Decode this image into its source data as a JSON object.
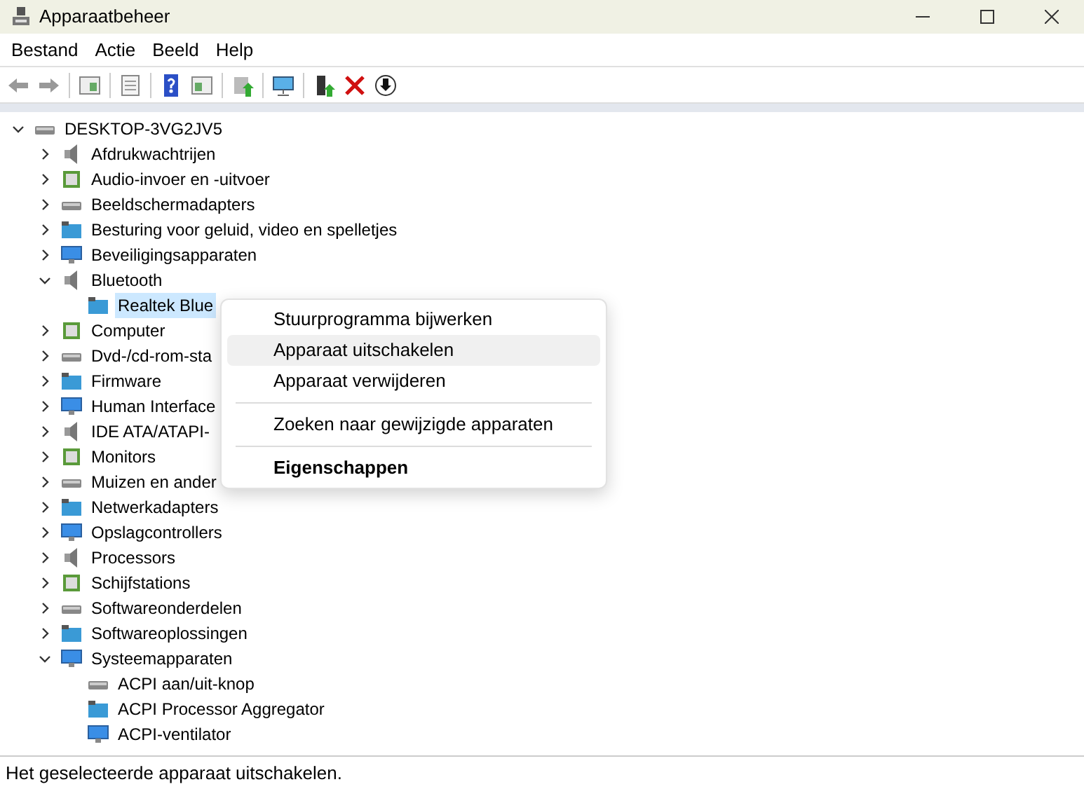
{
  "window": {
    "title": "Apparaatbeheer"
  },
  "menu_bar": [
    "Bestand",
    "Actie",
    "Beeld",
    "Help"
  ],
  "tree": {
    "label": "DESKTOP-3VG2JV5",
    "expanded": true,
    "selected": false,
    "children": [
      {
        "label": "Afdrukwachtrijen",
        "expanded": false,
        "selected": false
      },
      {
        "label": "Audio-invoer en -uitvoer",
        "expanded": false,
        "selected": false
      },
      {
        "label": "Beeldschermadapters",
        "expanded": false,
        "selected": false
      },
      {
        "label": "Besturing voor geluid, video en spelletjes",
        "expanded": false,
        "selected": false
      },
      {
        "label": "Beveiligingsapparaten",
        "expanded": false,
        "selected": false
      },
      {
        "label": "Bluetooth",
        "expanded": true,
        "selected": false,
        "children": [
          {
            "label": "Realtek Blue",
            "selected": true
          }
        ]
      },
      {
        "label": "Computer",
        "expanded": false,
        "selected": false
      },
      {
        "label": "Dvd-/cd-rom-sta",
        "expanded": false,
        "selected": false
      },
      {
        "label": "Firmware",
        "expanded": false,
        "selected": false
      },
      {
        "label": "Human Interface",
        "expanded": false,
        "selected": false
      },
      {
        "label": "IDE ATA/ATAPI-",
        "expanded": false,
        "selected": false
      },
      {
        "label": "Monitors",
        "expanded": false,
        "selected": false
      },
      {
        "label": "Muizen en ander",
        "expanded": false,
        "selected": false
      },
      {
        "label": "Netwerkadapters",
        "expanded": false,
        "selected": false
      },
      {
        "label": "Opslagcontrollers",
        "expanded": false,
        "selected": false
      },
      {
        "label": "Processors",
        "expanded": false,
        "selected": false
      },
      {
        "label": "Schijfstations",
        "expanded": false,
        "selected": false
      },
      {
        "label": "Softwareonderdelen",
        "expanded": false,
        "selected": false
      },
      {
        "label": "Softwareoplossingen",
        "expanded": false,
        "selected": false
      },
      {
        "label": "Systeemapparaten",
        "expanded": true,
        "selected": false,
        "children": [
          {
            "label": "ACPI aan/uit-knop",
            "selected": false
          },
          {
            "label": "ACPI Processor Aggregator",
            "selected": false
          },
          {
            "label": "ACPI-ventilator",
            "selected": false
          }
        ]
      }
    ]
  },
  "context_menu": [
    {
      "kind": "item",
      "label": "Stuurprogramma bijwerken",
      "highlighted": false,
      "default": false
    },
    {
      "kind": "item",
      "label": "Apparaat uitschakelen",
      "highlighted": true,
      "default": false
    },
    {
      "kind": "item",
      "label": "Apparaat verwijderen",
      "highlighted": false,
      "default": false
    },
    {
      "kind": "separator"
    },
    {
      "kind": "item",
      "label": "Zoeken naar gewijzigde apparaten",
      "highlighted": false,
      "default": false
    },
    {
      "kind": "separator"
    },
    {
      "kind": "item",
      "label": "Eigenschappen",
      "highlighted": false,
      "default": true
    }
  ],
  "status_bar": "Het geselecteerde apparaat uitschakelen."
}
